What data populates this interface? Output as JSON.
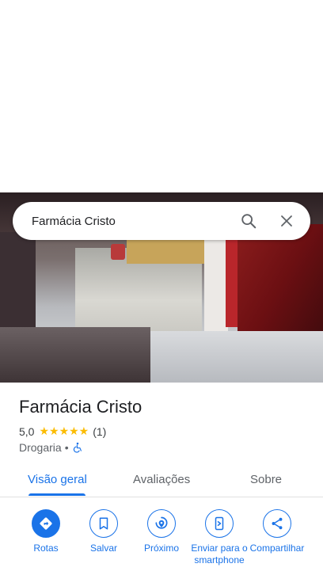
{
  "search": {
    "query": "Farmácia Cristo"
  },
  "place": {
    "name": "Farmácia Cristo",
    "rating": "5,0",
    "stars": "★★★★★",
    "review_count": "(1)",
    "category": "Drogaria",
    "separator": "•"
  },
  "tabs": [
    {
      "label": "Visão geral",
      "active": true
    },
    {
      "label": "Avaliações",
      "active": false
    },
    {
      "label": "Sobre",
      "active": false
    }
  ],
  "actions": [
    {
      "label": "Rotas",
      "icon": "directions-icon"
    },
    {
      "label": "Salvar",
      "icon": "bookmark-icon"
    },
    {
      "label": "Próximo",
      "icon": "nearby-icon"
    },
    {
      "label": "Enviar para o smartphone",
      "icon": "send-to-phone-icon"
    },
    {
      "label": "Compartilhar",
      "icon": "share-icon"
    }
  ],
  "colors": {
    "accent": "#1a73e8",
    "star": "#fbbc04"
  }
}
